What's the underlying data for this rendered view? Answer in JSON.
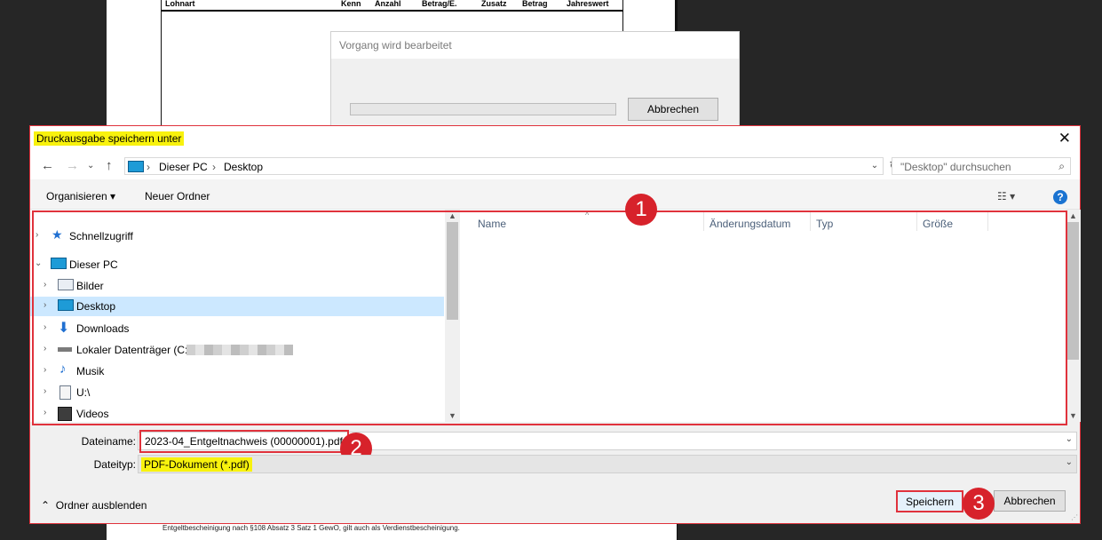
{
  "background_doc": {
    "columns": [
      "Lohnart",
      "Kenn",
      "Anzahl",
      "Betrag/E.",
      "Zusatz",
      "Betrag",
      "Jahreswert"
    ],
    "footer": "Entgeltbescheinigung nach §108 Absatz 3 Satz 1 GewO, gilt auch als Verdienstbescheinigung."
  },
  "progress_window": {
    "title": "Vorgang wird bearbeitet",
    "cancel_label": "Abbrechen",
    "progress": 0
  },
  "dialog": {
    "title": "Druckausgabe speichern unter",
    "close_icon": "close-icon",
    "address": [
      "Dieser PC",
      "Desktop"
    ],
    "search_placeholder": "\"Desktop\" durchsuchen",
    "toolbar": {
      "organize": "Organisieren ▾",
      "new_folder": "Neuer Ordner",
      "help": "?"
    },
    "tree": [
      {
        "label": "Schnellzugriff",
        "icon": "star-icon",
        "expanded": false
      },
      {
        "label": "Dieser PC",
        "icon": "computer-icon",
        "expanded": true
      },
      {
        "label": "Bilder",
        "icon": "pictures-icon"
      },
      {
        "label": "Desktop",
        "icon": "desktop-icon",
        "selected": true
      },
      {
        "label": "Downloads",
        "icon": "download-icon"
      },
      {
        "label": "Lokaler Datenträger (C:",
        "icon": "drive-icon"
      },
      {
        "label": "Musik",
        "icon": "music-icon"
      },
      {
        "label": "U:\\",
        "icon": "network-drive-icon"
      },
      {
        "label": "Videos",
        "icon": "video-icon"
      }
    ],
    "columns": [
      "Name",
      "Änderungsdatum",
      "Typ",
      "Größe"
    ],
    "filename_label": "Dateiname:",
    "filename_value": "2023-04_Entgeltnachweis (00000001).pdf",
    "filetype_label": "Dateityp:",
    "filetype_value": "PDF-Dokument (*.pdf)",
    "hide_folders": "Ordner ausblenden",
    "save_label": "Speichern",
    "cancel_label": "Abbrechen"
  },
  "annotations": [
    "1",
    "2",
    "3"
  ],
  "colors": {
    "annotation_red": "#d7222b",
    "highlight_yellow": "#f8f20d",
    "selection_blue": "#cce8ff"
  }
}
